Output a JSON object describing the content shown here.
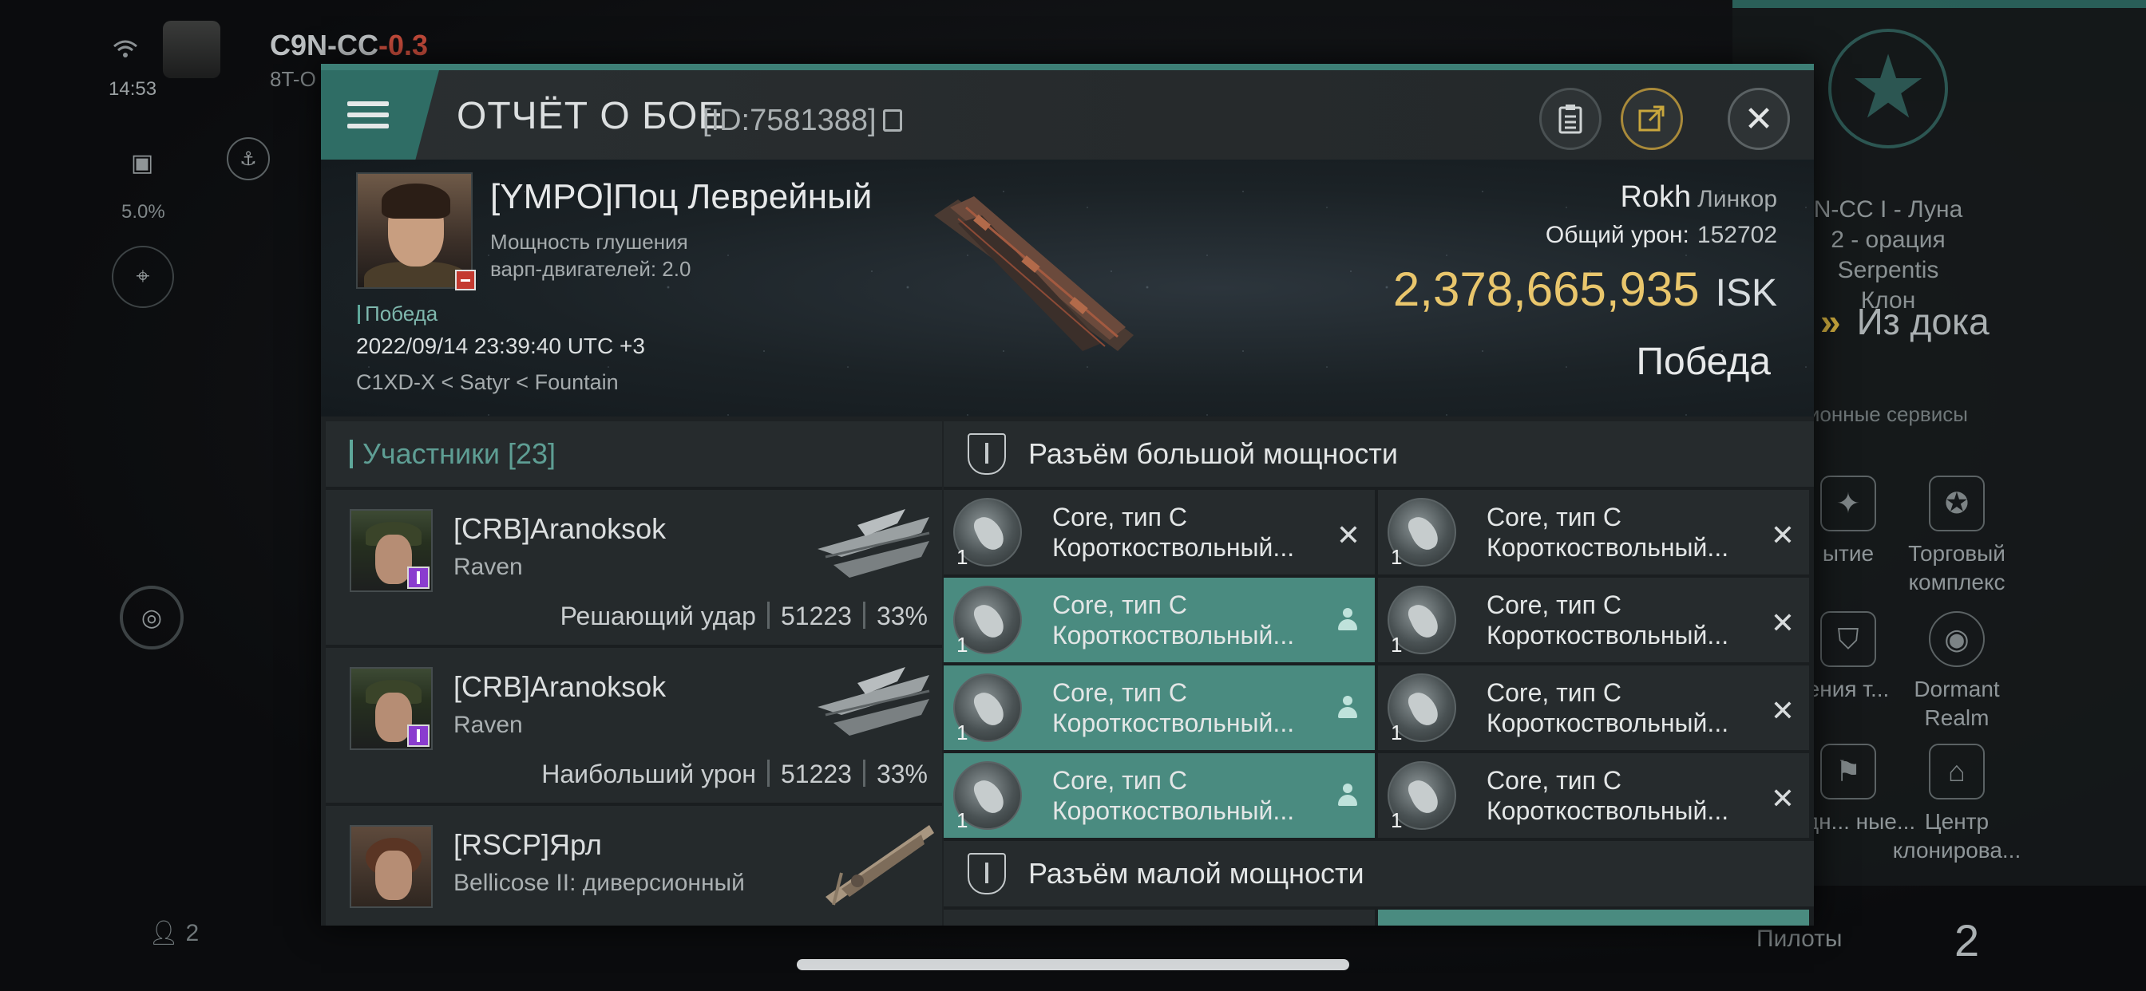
{
  "background": {
    "system_name": "C9N-CC",
    "system_sec": "-0.3",
    "system_sub": "8T-O",
    "time": "14:53",
    "cargo_pct": "5.0%",
    "location_text": "N-CC I - Луна 2 - орация Serpentis Клон",
    "undock_label": "Из дока",
    "services_label": "ционные сервисы",
    "services": [
      {
        "label": "ытие",
        "icon": "hammer-icon"
      },
      {
        "label": "Торговый комплекс",
        "icon": "nes-icon"
      },
      {
        "label": "ения т...",
        "icon": "shield-icon"
      },
      {
        "label": "Dormant Realm",
        "icon": "portal-icon"
      },
      {
        "label": "нндн... ные...",
        "icon": "flag-icon"
      },
      {
        "label": "Центр клонирова...",
        "icon": "clone-icon"
      }
    ],
    "pilots_label": "Пилоты",
    "pilots_count": "2",
    "local_count": "2"
  },
  "header": {
    "title": "ОТЧЁТ О БОЕ",
    "report_id": "[ID:7581388]"
  },
  "summary": {
    "victim_name": "[YMPO]Поц Леврейный",
    "victim_attr_line1": "Мощность глушения",
    "victim_attr_line2": "варп-двигателей: 2.0",
    "victory_tag": "Победа",
    "date": "2022/09/14 23:39:40 UTC +3",
    "location": "C1XD-X < Satyr < Fountain",
    "ship_name": "Rokh",
    "ship_class": "Линкор",
    "damage_label": "Общий урон:",
    "damage_value": "152702",
    "isk_value": "2,378,665,935",
    "isk_unit": "ISK",
    "result": "Победа"
  },
  "participants": {
    "header": "Участники [23]",
    "rows": [
      {
        "name": "[CRB]Aranoksok",
        "ship": "Raven",
        "role": "Решающий удар",
        "damage": "51223",
        "pct": "33%"
      },
      {
        "name": "[CRB]Aranoksok",
        "ship": "Raven",
        "role": "Наибольший урон",
        "damage": "51223",
        "pct": "33%"
      },
      {
        "name": "[RSCP]Ярл",
        "ship": "Bellicose II: диверсионный",
        "role": "",
        "damage": "",
        "pct": ""
      }
    ]
  },
  "modules": {
    "high_slot_label": "Разъём большой мощности",
    "low_slot_label": "Разъём малой мощности",
    "items": [
      {
        "line1": "Core, тип C",
        "line2": "Короткоствольный...",
        "qty": "1",
        "state": "destroyed"
      },
      {
        "line1": "Core, тип C",
        "line2": "Короткоствольный...",
        "qty": "1",
        "state": "destroyed"
      },
      {
        "line1": "Core, тип C",
        "line2": "Короткоствольный...",
        "qty": "1",
        "state": "dropped"
      },
      {
        "line1": "Core, тип C",
        "line2": "Короткоствольный...",
        "qty": "1",
        "state": "destroyed"
      },
      {
        "line1": "Core, тип C",
        "line2": "Короткоствольный...",
        "qty": "1",
        "state": "dropped"
      },
      {
        "line1": "Core, тип C",
        "line2": "Короткоствольный...",
        "qty": "1",
        "state": "destroyed"
      },
      {
        "line1": "Core, тип C",
        "line2": "Короткоствольный...",
        "qty": "1",
        "state": "dropped"
      },
      {
        "line1": "Core, тип C",
        "line2": "Короткоствольный...",
        "qty": "1",
        "state": "destroyed"
      }
    ]
  }
}
